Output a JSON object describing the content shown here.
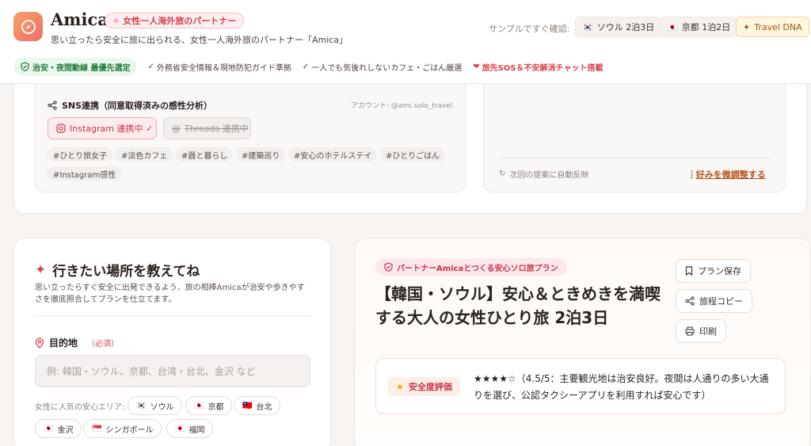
{
  "header": {
    "brand": "Amica",
    "tagline_badge": "女性一人海外旅のパートナー",
    "subtitle": "思い立ったら安全に旅に出られる、女性一人海外旅のパートナー「Amica」",
    "sample_label": "サンプルですぐ確認:",
    "samples": [
      {
        "flag": "🇰🇷",
        "label": "ソウル 2泊3日"
      },
      {
        "flag": "🇯🇵",
        "label": "京都 1泊2日"
      }
    ],
    "travel_dna_label": "Travel DNA"
  },
  "features": {
    "safety": "治安・夜間動線 最優先選定",
    "items": [
      "外務省安全情報＆現地防犯ガイド準拠",
      "一人でも気後れしないカフェ・ごはん厳選"
    ],
    "sos": "旅先SOS＆不安解消チャット搭載"
  },
  "sns": {
    "title": "SNS連携（同意取得済みの感性分析）",
    "account": "アカウント: @ami.solo_travel",
    "instagram_label": "Instagram 連携中 ✓",
    "threads_label": "Threads 連携中",
    "hashtags": [
      "#ひとり旅女子",
      "#淡色カフェ",
      "#器と暮らし",
      "#建築巡り",
      "#安心のホテルステイ",
      "#ひとりごはん",
      "#Instagram感性"
    ]
  },
  "preference": {
    "auto_note": "次回の提案に自動反映",
    "tune_link": "好みを微調整する"
  },
  "query": {
    "title": "行きたい場所を教えてね",
    "description": "思い立ったらすぐ安全に出発できるよう、旅の相棒Amicaが治安や歩きやすさを徹底照合してプランを仕立てます。",
    "destination_label": "目的地",
    "required": "（必須）",
    "destination_placeholder": "例: 韓国・ソウル、京都、台湾・台北、金沢 など",
    "popular_label": "女性に人気の安心エリア:",
    "areas": [
      {
        "flag": "🇰🇷",
        "label": "ソウル"
      },
      {
        "flag": "🇯🇵",
        "label": "京都"
      },
      {
        "flag": "🇹🇼",
        "label": "台北"
      },
      {
        "flag": "🇯🇵",
        "label": "金沢"
      },
      {
        "flag": "🇸🇬",
        "label": "シンガポール"
      },
      {
        "flag": "🇯🇵",
        "label": "福岡"
      }
    ]
  },
  "plan": {
    "badge": "パートナーAmicaとつくる安心ソロ旅プラン",
    "title": "【韓国・ソウル】安心＆ときめきを満喫する大人の女性ひとり旅 2泊3日",
    "save_label": "プラン保存",
    "copy_label": "旅程コピー",
    "print_label": "印刷",
    "safety_badge": "安全度評価",
    "safety_text": "★★★★☆（4.5/5：主要観光地は治安良好。夜間は人通りの多い大通りを選び、公認タクシーアプリを利用すれば安心です）"
  },
  "colors": {
    "accent": "#d8434f",
    "brand_gradient_start": "#f7a168",
    "brand_gradient_end": "#ef6f6a",
    "safe_green": "#1f7a3a"
  }
}
